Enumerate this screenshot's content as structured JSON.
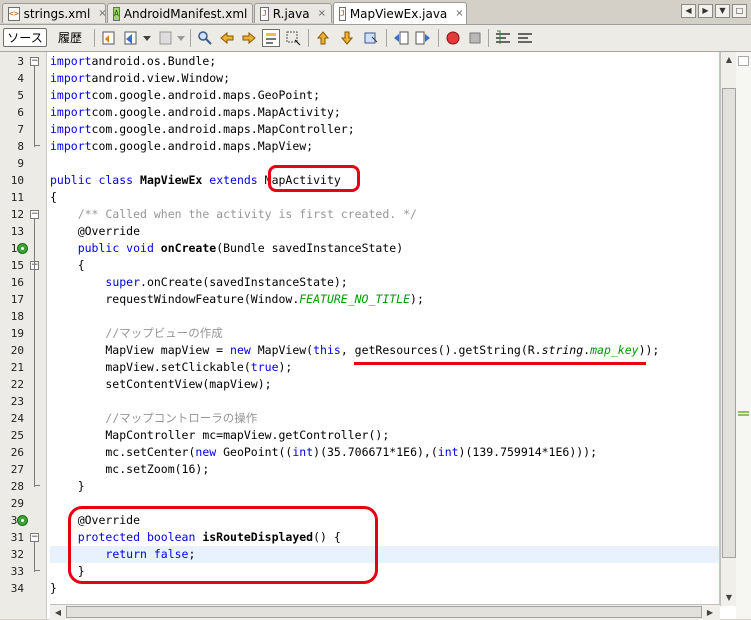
{
  "tabs": [
    {
      "label": "strings.xml",
      "icon": "xml-file-icon",
      "active": false
    },
    {
      "label": "AndroidManifest.xml",
      "icon": "manifest-file-icon",
      "active": false
    },
    {
      "label": "R.java",
      "icon": "java-file-icon",
      "active": false
    },
    {
      "label": "MapViewEx.java",
      "icon": "java-file-icon",
      "active": true
    }
  ],
  "tab_close_glyph": "×",
  "toolbar": {
    "source_label": "ソース",
    "history_label": "履歴"
  },
  "lines": [
    {
      "n": "3",
      "t": [
        [
          "kw",
          "import"
        ],
        [
          "",
          "android.os.Bundle;"
        ]
      ]
    },
    {
      "n": "4",
      "t": [
        [
          "kw",
          "import"
        ],
        [
          "",
          "android.view.Window;"
        ]
      ]
    },
    {
      "n": "5",
      "t": [
        [
          "kw",
          "import"
        ],
        [
          "",
          "com.google.android.maps.GeoPoint;"
        ]
      ]
    },
    {
      "n": "6",
      "t": [
        [
          "kw",
          "import"
        ],
        [
          "",
          "com.google.android.maps.MapActivity;"
        ]
      ]
    },
    {
      "n": "7",
      "t": [
        [
          "kw",
          "import"
        ],
        [
          "",
          "com.google.android.maps.MapController;"
        ]
      ]
    },
    {
      "n": "8",
      "t": [
        [
          "kw",
          "import"
        ],
        [
          "",
          "com.google.android.maps.MapView;"
        ]
      ]
    },
    {
      "n": "9",
      "t": []
    },
    {
      "n": "10",
      "t": [
        [
          "kw",
          "public class "
        ],
        [
          "bd",
          "MapViewEx "
        ],
        [
          "kw",
          "extends "
        ],
        [
          "",
          "MapActivity"
        ]
      ]
    },
    {
      "n": "11",
      "t": [
        [
          "",
          "{"
        ]
      ]
    },
    {
      "n": "12",
      "t": [
        [
          "",
          "    "
        ],
        [
          "cm",
          "/** Called when the activity is first created. */"
        ]
      ]
    },
    {
      "n": "13",
      "t": [
        [
          "",
          "    @Override"
        ]
      ]
    },
    {
      "n": "14",
      "t": [
        [
          "",
          "    "
        ],
        [
          "kw",
          "public void "
        ],
        [
          "bd",
          "onCreate"
        ],
        [
          "",
          "(Bundle savedInstanceState)"
        ]
      ]
    },
    {
      "n": "15",
      "t": [
        [
          "",
          "    {"
        ]
      ]
    },
    {
      "n": "16",
      "t": [
        [
          "",
          "        "
        ],
        [
          "kw",
          "super"
        ],
        [
          "",
          ".onCreate(savedInstanceState);"
        ]
      ]
    },
    {
      "n": "17",
      "t": [
        [
          "",
          "        requestWindowFeature(Window."
        ],
        [
          "gr",
          "FEATURE_NO_TITLE"
        ],
        [
          "",
          ");"
        ]
      ]
    },
    {
      "n": "18",
      "t": []
    },
    {
      "n": "19",
      "t": [
        [
          "",
          "        "
        ],
        [
          "cm",
          "//マップビューの作成"
        ]
      ]
    },
    {
      "n": "20",
      "t": [
        [
          "",
          "        MapView mapView = "
        ],
        [
          "kw",
          "new "
        ],
        [
          "",
          "MapView("
        ],
        [
          "kw",
          "this"
        ],
        [
          "",
          ", getResources().getString(R."
        ],
        [
          "i",
          "string"
        ],
        [
          "",
          "."
        ],
        [
          "gr",
          "map_key"
        ],
        [
          "",
          "));"
        ]
      ]
    },
    {
      "n": "21",
      "t": [
        [
          "",
          "        mapView.setClickable("
        ],
        [
          "kw",
          "true"
        ],
        [
          "",
          ");"
        ]
      ]
    },
    {
      "n": "22",
      "t": [
        [
          "",
          "        setContentView(mapView);"
        ]
      ]
    },
    {
      "n": "23",
      "t": []
    },
    {
      "n": "24",
      "t": [
        [
          "",
          "        "
        ],
        [
          "cm",
          "//マップコントローラの操作"
        ]
      ]
    },
    {
      "n": "25",
      "t": [
        [
          "",
          "        MapController mc=mapView.getController();"
        ]
      ]
    },
    {
      "n": "26",
      "t": [
        [
          "",
          "        mc.setCenter("
        ],
        [
          "kw",
          "new "
        ],
        [
          "",
          "GeoPoint(("
        ],
        [
          "kw",
          "int"
        ],
        [
          "",
          ")(35.706671*1E6),("
        ],
        [
          "kw",
          "int"
        ],
        [
          "",
          ")(139.759914*1E6)));"
        ]
      ]
    },
    {
      "n": "27",
      "t": [
        [
          "",
          "        mc.setZoom(16);"
        ]
      ]
    },
    {
      "n": "28",
      "t": [
        [
          "",
          "    }"
        ]
      ]
    },
    {
      "n": "29",
      "t": []
    },
    {
      "n": "30",
      "t": [
        [
          "",
          "    @Override"
        ]
      ]
    },
    {
      "n": "31",
      "t": [
        [
          "",
          "    "
        ],
        [
          "kw",
          "protected boolean "
        ],
        [
          "bd",
          "isRouteDisplayed"
        ],
        [
          "",
          "() {"
        ]
      ]
    },
    {
      "n": "32",
      "t": [
        [
          "",
          "        "
        ],
        [
          "kw",
          "return false"
        ],
        [
          "",
          ";"
        ]
      ]
    },
    {
      "n": "33",
      "t": [
        [
          "",
          "    }"
        ]
      ]
    },
    {
      "n": "34",
      "t": [
        [
          "",
          "}"
        ]
      ]
    }
  ],
  "colors": {
    "annotation_red": "#e60012",
    "keyword": "#0000e6",
    "comment": "#969696",
    "constant": "#009900"
  }
}
